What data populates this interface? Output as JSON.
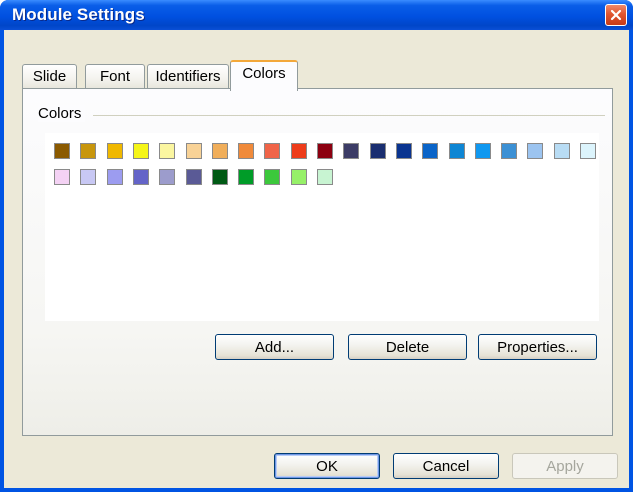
{
  "window": {
    "title": "Module Settings"
  },
  "tabs": [
    {
      "label": "Slide"
    },
    {
      "label": "Font"
    },
    {
      "label": "Identifiers"
    },
    {
      "label": "Colors"
    }
  ],
  "colors_group": {
    "label": "Colors",
    "swatches_row1": [
      "#8b5a00",
      "#c8960c",
      "#f0b800",
      "#f5f518",
      "#fbf6a0",
      "#f8d296",
      "#f0ae5a",
      "#f08a3a",
      "#f06448",
      "#ee3c1a",
      "#8c0010",
      "#3c3c66",
      "#1a2e70",
      "#0a3490",
      "#0a64c8",
      "#0e86d4",
      "#1098f0",
      "#3c90d4",
      "#9cc4f0",
      "#b8dcf4",
      "#dcf4fc"
    ],
    "swatches_row2": [
      "#f4d2f4",
      "#c8c8f4",
      "#9c9cf0",
      "#6464c8",
      "#9c9ccc",
      "#5a5a96",
      "#005a14",
      "#009c28",
      "#3cc83c",
      "#96f068",
      "#c8f4d2"
    ],
    "buttons": {
      "add": "Add...",
      "delete": "Delete",
      "properties": "Properties..."
    }
  },
  "footer": {
    "ok": "OK",
    "cancel": "Cancel",
    "apply": "Apply"
  }
}
